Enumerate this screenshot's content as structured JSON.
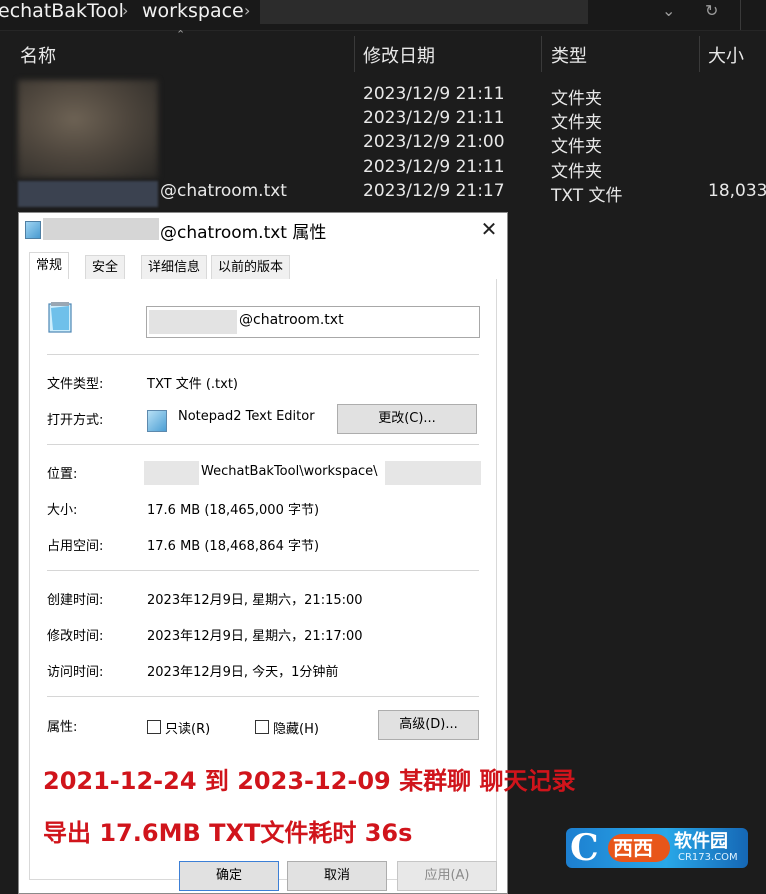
{
  "breadcrumb": {
    "segment1": "echatBakTool",
    "separator": "›",
    "segment2": "workspace",
    "separator2": "›"
  },
  "toolbar": {
    "dropdown_icon": "chevron-down-icon",
    "refresh_icon": "refresh-icon",
    "chevron_glyph": "⌄",
    "refresh_glyph": "↻"
  },
  "columns": {
    "name": "名称",
    "modified": "修改日期",
    "type": "类型",
    "size": "大小",
    "sort_arrow": "⌃"
  },
  "rows": [
    {
      "modified": "2023/12/9 21:11",
      "type": "文件夹",
      "size": ""
    },
    {
      "modified": "2023/12/9 21:11",
      "type": "文件夹",
      "size": ""
    },
    {
      "modified": "2023/12/9 21:00",
      "type": "文件夹",
      "size": ""
    },
    {
      "modified": "2023/12/9 21:11",
      "type": "文件夹",
      "size": ""
    },
    {
      "name_suffix": "@chatroom.txt",
      "modified": "2023/12/9 21:17",
      "type": "TXT 文件",
      "size": "18,033"
    }
  ],
  "dialog": {
    "title_suffix": "@chatroom.txt 属性",
    "close_glyph": "✕",
    "tabs": [
      "常规",
      "安全",
      "详细信息",
      "以前的版本"
    ],
    "file_name_suffix": "@chatroom.txt",
    "file_type_label": "文件类型:",
    "file_type_value": "TXT 文件 (.txt)",
    "open_with_label": "打开方式:",
    "open_with_value": "Notepad2 Text Editor",
    "change_button": "更改(C)...",
    "location_label": "位置:",
    "location_value": "WechatBakTool\\workspace\\",
    "size_label": "大小:",
    "size_value": "17.6 MB (18,465,000 字节)",
    "size_on_disk_label": "占用空间:",
    "size_on_disk_value": "17.6 MB (18,468,864 字节)",
    "created_label": "创建时间:",
    "created_value": "2023年12月9日, 星期六，21:15:00",
    "modified_label": "修改时间:",
    "modified_value": "2023年12月9日, 星期六，21:17:00",
    "accessed_label": "访问时间:",
    "accessed_value": "2023年12月9日, 今天，1分钟前",
    "attributes_label": "属性:",
    "readonly_label": "只读(R)",
    "hidden_label": "隐藏(H)",
    "advanced_button": "高级(D)...",
    "ok_button": "确定",
    "cancel_button": "取消",
    "apply_button": "应用(A)"
  },
  "annotation": {
    "line1": "2021-12-24 到 2023-12-09 某群聊 聊天记录",
    "line2": "导出 17.6MB TXT文件耗时 36s"
  },
  "watermark": {
    "brand_letter": "C",
    "badge_text": "西西",
    "name": "软件园",
    "url": "CR173.COM"
  },
  "colors": {
    "explorer_bg": "#1c1c1c",
    "dialog_bg": "#ffffff",
    "annotation_red": "#d0141b",
    "watermark_blue": "#1d7fd0"
  }
}
